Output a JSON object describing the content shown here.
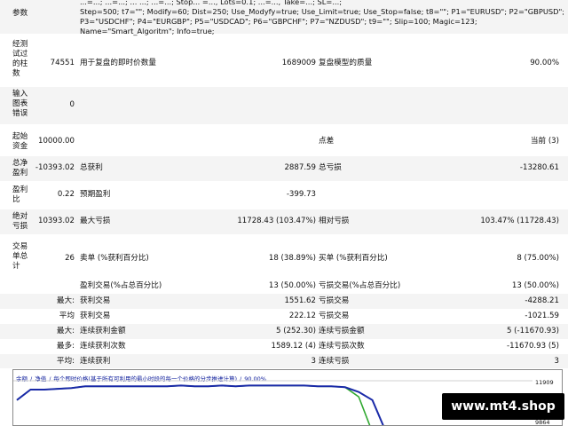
{
  "params": {
    "label": "参数",
    "lines": [
      "...=...; ...=...; ... ...; ...=...; Stop... =..., Lots=0.1; ...=..., Take=...; SL=...;",
      "Step=500; t7=\"\"; Modify=60; Dist=250; Use_Modyfy=true; Use_Limit=true; Use_Stop=false; t8=\"\"; P1=\"EURUSD\"; P2=\"GBPUSD\";",
      "P3=\"USDCHF\"; P4=\"EURGBP\"; P5=\"USDCAD\"; P6=\"GBPCHF\"; P7=\"NZDUSD\"; t9=\"\"; Slip=100; Magic=123;",
      "Name=\"Smart_Algoritm\"; Info=true;"
    ]
  },
  "stats": {
    "bars": {
      "label": "经测试过的柱数",
      "value": "74551",
      "ticks_label": "用于复盘的即时价数量",
      "ticks_value": "1689009",
      "quality_label": "复盘模型的质量",
      "quality_value": "90.00%"
    },
    "errors": {
      "label": "输入图表错误",
      "value": "0"
    },
    "deposit": {
      "label": "起始资金",
      "value": "10000.00",
      "spread_label": "点差",
      "spread_value": "当前 (3)"
    },
    "netprofit": {
      "label": "总净盈利",
      "value": "-10393.02",
      "gross_profit_label": "总获利",
      "gross_profit_value": "2887.59",
      "gross_loss_label": "总亏损",
      "gross_loss_value": "-13280.61"
    },
    "profitfactor": {
      "label": "盈利比",
      "value": "0.22",
      "expected_label": "预期盈利",
      "expected_value": "-399.73"
    },
    "absdd": {
      "label": "绝对亏损",
      "value": "10393.02",
      "maxdd_label": "最大亏损",
      "maxdd_value": "11728.43 (103.47%)",
      "reldd_label": "相对亏损",
      "reldd_value": "103.47% (11728.43)"
    },
    "trades": {
      "label": "交易单总计",
      "value": "26",
      "short_label": "卖单 (%获利百分比)",
      "short_value": "18 (38.89%)",
      "long_label": "买单 (%获利百分比)",
      "long_value": "8 (75.00%)"
    },
    "win": {
      "label": "盈利交易(%占总百分比)",
      "value": "13 (50.00%)",
      "loss_label": "亏损交易(%占总百分比)",
      "loss_value": "13 (50.00%)"
    },
    "largest": {
      "label": "最大:",
      "profit_label": "获利交易",
      "profit_value": "1551.62",
      "loss_label": "亏损交易",
      "loss_value": "-4288.21"
    },
    "average": {
      "label": "平均",
      "profit_label": "获利交易",
      "profit_value": "222.12",
      "loss_label": "亏损交易",
      "loss_value": "-1021.59"
    },
    "maxcons": {
      "label": "最大:",
      "wins_label": "连续获利金额",
      "wins_value": "5 (252.30)",
      "losses_label": "连续亏损金额",
      "losses_value": "5 (-11670.93)"
    },
    "maxconsamt": {
      "label": "最多:",
      "wins_label": "连续获利次数",
      "wins_value": "1589.12 (4)",
      "losses_label": "连续亏损次数",
      "losses_value": "-11670.93 (5)"
    },
    "avgcons": {
      "label": "平均:",
      "wins_label": "连续获利",
      "wins_value": "3",
      "losses_label": "连续亏损",
      "losses_value": "3"
    }
  },
  "chart": {
    "caption_parts": [
      "余额",
      "/",
      "净值",
      "/",
      "每个即时价格(基于所有可利用的最小时段的每一个价格的分步推进计算)",
      "/",
      "90.00%"
    ],
    "y_ticks": [
      "11909",
      "9864"
    ],
    "colors": {
      "balance": "#1a2aa8",
      "equity": "#2fa82f",
      "caption": "#0a1a9a"
    }
  },
  "chart_data": {
    "type": "line",
    "ylim": [
      9000,
      12200
    ],
    "series": [
      {
        "name": "余额",
        "values": [
          11000,
          11650,
          11650,
          11700,
          11750,
          11850,
          11850,
          11850,
          11850,
          11850,
          11850,
          11850,
          11900,
          11850,
          11850,
          11900,
          11850,
          11900,
          11900,
          11900,
          11900,
          11900,
          11850,
          11850,
          11800,
          11500,
          11000,
          9000
        ]
      },
      {
        "name": "净值",
        "values": [
          11000,
          11650,
          11650,
          11700,
          11750,
          11850,
          11850,
          11850,
          11850,
          11850,
          11850,
          11850,
          11900,
          11850,
          11850,
          11900,
          11850,
          11900,
          11900,
          11900,
          11900,
          11900,
          11850,
          11850,
          11800,
          11200,
          9000,
          9000
        ]
      }
    ]
  },
  "watermark": "www.mt4.shop"
}
